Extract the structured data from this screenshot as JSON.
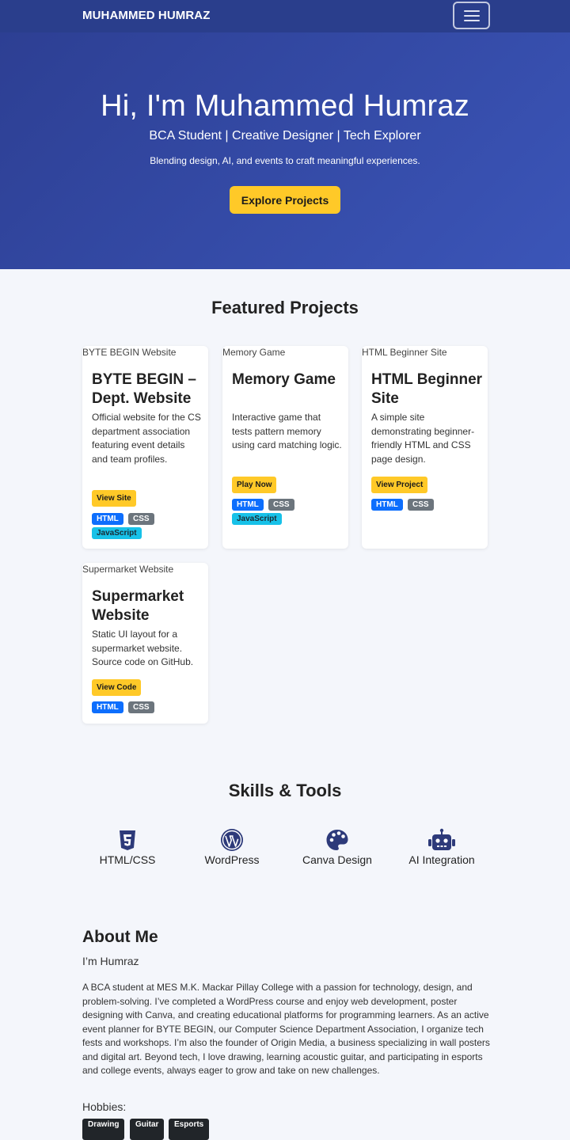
{
  "navbar": {
    "brand": "MUHAMMED HUMRAZ",
    "menu_icon": "hamburger-icon"
  },
  "hero": {
    "title": "Hi, I'm Muhammed Humraz",
    "tagline": "BCA Student | Creative Designer | Tech Explorer",
    "subtitle": "Blending design, AI, and events to craft meaningful experiences.",
    "cta_label": "Explore Projects"
  },
  "projects": {
    "heading": "Featured Projects",
    "items": [
      {
        "image_alt": "BYTE BEGIN Website",
        "title": "BYTE BEGIN – Dept. Website",
        "description": "Official website for the CS department association featuring event details and team profiles.",
        "button": "View Site",
        "tags": [
          "HTML",
          "CSS",
          "JavaScript"
        ]
      },
      {
        "image_alt": "Memory Game",
        "title": "Memory Game",
        "description": "Interactive game that tests pattern memory using card matching logic.",
        "button": "Play Now",
        "tags": [
          "HTML",
          "CSS",
          "JavaScript"
        ]
      },
      {
        "image_alt": "HTML Beginner Site",
        "title": "HTML Beginner Site",
        "description": "A simple site demonstrating beginner-friendly HTML and CSS page design.",
        "button": "View Project",
        "tags": [
          "HTML",
          "CSS"
        ]
      },
      {
        "image_alt": "Supermarket Website",
        "title": "Supermarket Website",
        "description": "Static UI layout for a supermarket website. Source code on GitHub.",
        "button": "View Code",
        "tags": [
          "HTML",
          "CSS"
        ]
      }
    ]
  },
  "skills": {
    "heading": "Skills & Tools",
    "items": [
      {
        "label": "HTML/CSS",
        "icon": "html5-icon"
      },
      {
        "label": "WordPress",
        "icon": "wordpress-icon"
      },
      {
        "label": "Canva Design",
        "icon": "palette-icon"
      },
      {
        "label": "AI Integration",
        "icon": "robot-icon"
      }
    ]
  },
  "about": {
    "heading": "About Me",
    "subheading": "I’m Humraz",
    "text": "A BCA student at MES M.K. Mackar Pillay College with a passion for technology, design, and problem-solving. I’ve completed a WordPress course and enjoy web development, poster designing with Canva, and creating educational platforms for programming learners. As an active event planner for BYTE BEGIN, our Computer Science Department Association, I organize tech fests and workshops. I’m also the founder of Origin Media, a business specializing in wall posters and digital art. Beyond tech, I love drawing, learning acoustic guitar, and participating in esports and college events, always eager to grow and take on new challenges.",
    "hobbies_label": "Hobbies:",
    "hobbies": [
      "Drawing",
      "Guitar",
      "Esports"
    ]
  },
  "colors": {
    "navbar": "#2a3e8c",
    "hero_start": "#2d3f93",
    "hero_end": "#3b55b8",
    "accent": "#ffc928",
    "skill_icon": "#2d3a7a"
  }
}
